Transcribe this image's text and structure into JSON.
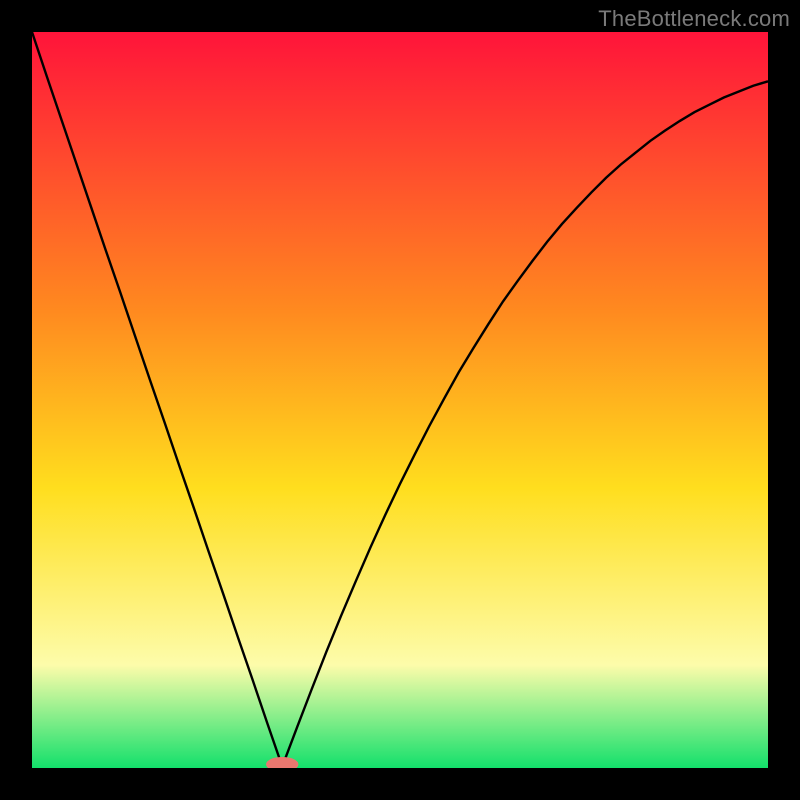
{
  "attribution": "TheBottleneck.com",
  "colors": {
    "gradient_top": "#ff143a",
    "gradient_mid_upper": "#ff8a1f",
    "gradient_mid": "#ffde1e",
    "gradient_mid_lower": "#fdfcaa",
    "gradient_bottom": "#13e06b",
    "curve": "#000000",
    "marker": "#ea776f",
    "frame": "#000000"
  },
  "chart_data": {
    "type": "line",
    "title": "",
    "xlabel": "",
    "ylabel": "",
    "xlim": [
      0,
      100
    ],
    "ylim": [
      0,
      100
    ],
    "optimum_x": 34,
    "x": [
      0,
      2,
      4,
      6,
      8,
      10,
      12,
      14,
      16,
      18,
      20,
      22,
      24,
      26,
      28,
      30,
      32,
      34,
      36,
      38,
      40,
      42,
      44,
      46,
      48,
      50,
      52,
      54,
      56,
      58,
      60,
      62,
      64,
      66,
      68,
      70,
      72,
      74,
      76,
      78,
      80,
      82,
      84,
      86,
      88,
      90,
      92,
      94,
      96,
      98,
      100
    ],
    "y": [
      100,
      94.0,
      88.1,
      82.2,
      76.3,
      70.4,
      64.6,
      58.7,
      52.8,
      47.0,
      41.1,
      35.3,
      29.4,
      23.6,
      17.7,
      11.9,
      6.0,
      0.2,
      5.5,
      10.7,
      15.8,
      20.7,
      25.4,
      30.0,
      34.4,
      38.6,
      42.6,
      46.5,
      50.2,
      53.8,
      57.1,
      60.3,
      63.4,
      66.2,
      68.9,
      71.5,
      73.9,
      76.1,
      78.2,
      80.2,
      82.0,
      83.6,
      85.2,
      86.6,
      87.9,
      89.1,
      90.1,
      91.1,
      91.9,
      92.7,
      93.3
    ],
    "marker": {
      "x": 34,
      "y": 0.5,
      "rx": 2.2,
      "ry": 1.0
    },
    "annotations": [],
    "legend": null
  }
}
